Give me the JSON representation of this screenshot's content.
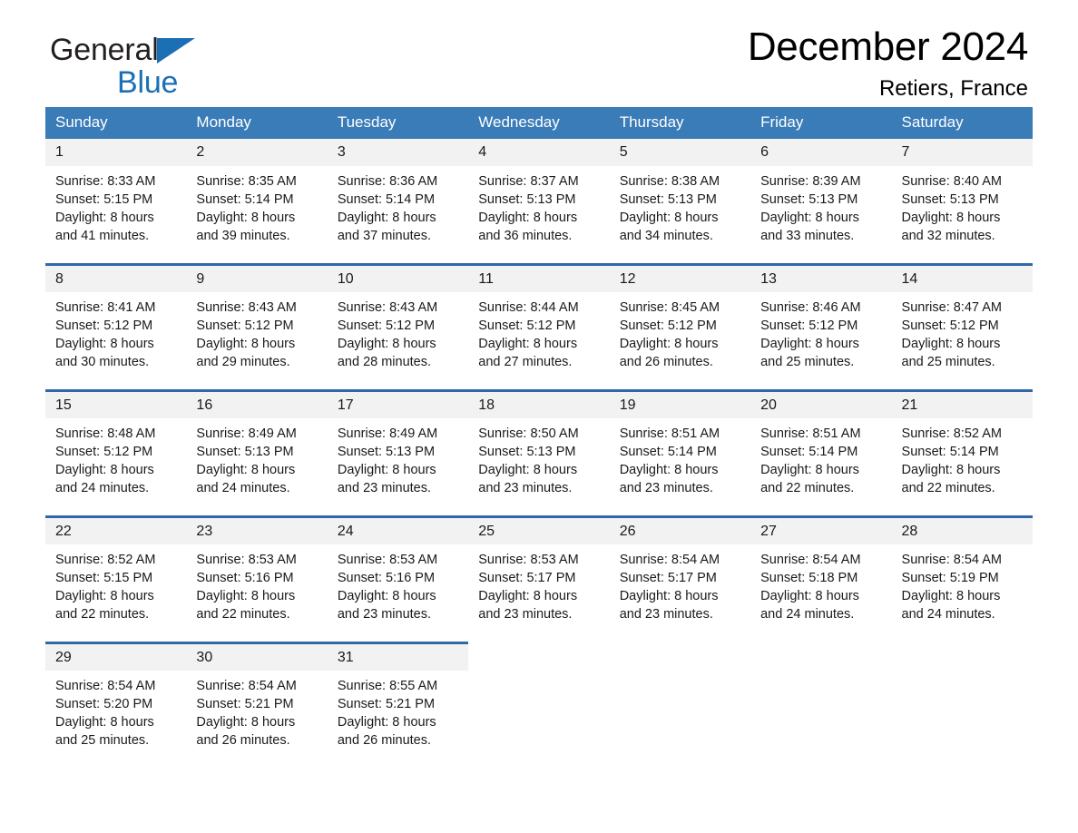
{
  "brand": {
    "word1": "General",
    "word2": "Blue",
    "flag_icon": "triangle-flag-icon",
    "accent_color": "#1a6fb5"
  },
  "header": {
    "month_title": "December 2024",
    "location": "Retiers, France"
  },
  "calendar": {
    "header_bg": "#3a7cb8",
    "daynum_bg": "#f2f2f2",
    "row_rule_color": "#2f6aa8",
    "weekday_headers": [
      "Sunday",
      "Monday",
      "Tuesday",
      "Wednesday",
      "Thursday",
      "Friday",
      "Saturday"
    ],
    "weeks": [
      [
        {
          "day": "1",
          "sunrise": "Sunrise: 8:33 AM",
          "sunset": "Sunset: 5:15 PM",
          "daylight_line1": "Daylight: 8 hours",
          "daylight_line2": "and 41 minutes."
        },
        {
          "day": "2",
          "sunrise": "Sunrise: 8:35 AM",
          "sunset": "Sunset: 5:14 PM",
          "daylight_line1": "Daylight: 8 hours",
          "daylight_line2": "and 39 minutes."
        },
        {
          "day": "3",
          "sunrise": "Sunrise: 8:36 AM",
          "sunset": "Sunset: 5:14 PM",
          "daylight_line1": "Daylight: 8 hours",
          "daylight_line2": "and 37 minutes."
        },
        {
          "day": "4",
          "sunrise": "Sunrise: 8:37 AM",
          "sunset": "Sunset: 5:13 PM",
          "daylight_line1": "Daylight: 8 hours",
          "daylight_line2": "and 36 minutes."
        },
        {
          "day": "5",
          "sunrise": "Sunrise: 8:38 AM",
          "sunset": "Sunset: 5:13 PM",
          "daylight_line1": "Daylight: 8 hours",
          "daylight_line2": "and 34 minutes."
        },
        {
          "day": "6",
          "sunrise": "Sunrise: 8:39 AM",
          "sunset": "Sunset: 5:13 PM",
          "daylight_line1": "Daylight: 8 hours",
          "daylight_line2": "and 33 minutes."
        },
        {
          "day": "7",
          "sunrise": "Sunrise: 8:40 AM",
          "sunset": "Sunset: 5:13 PM",
          "daylight_line1": "Daylight: 8 hours",
          "daylight_line2": "and 32 minutes."
        }
      ],
      [
        {
          "day": "8",
          "sunrise": "Sunrise: 8:41 AM",
          "sunset": "Sunset: 5:12 PM",
          "daylight_line1": "Daylight: 8 hours",
          "daylight_line2": "and 30 minutes."
        },
        {
          "day": "9",
          "sunrise": "Sunrise: 8:43 AM",
          "sunset": "Sunset: 5:12 PM",
          "daylight_line1": "Daylight: 8 hours",
          "daylight_line2": "and 29 minutes."
        },
        {
          "day": "10",
          "sunrise": "Sunrise: 8:43 AM",
          "sunset": "Sunset: 5:12 PM",
          "daylight_line1": "Daylight: 8 hours",
          "daylight_line2": "and 28 minutes."
        },
        {
          "day": "11",
          "sunrise": "Sunrise: 8:44 AM",
          "sunset": "Sunset: 5:12 PM",
          "daylight_line1": "Daylight: 8 hours",
          "daylight_line2": "and 27 minutes."
        },
        {
          "day": "12",
          "sunrise": "Sunrise: 8:45 AM",
          "sunset": "Sunset: 5:12 PM",
          "daylight_line1": "Daylight: 8 hours",
          "daylight_line2": "and 26 minutes."
        },
        {
          "day": "13",
          "sunrise": "Sunrise: 8:46 AM",
          "sunset": "Sunset: 5:12 PM",
          "daylight_line1": "Daylight: 8 hours",
          "daylight_line2": "and 25 minutes."
        },
        {
          "day": "14",
          "sunrise": "Sunrise: 8:47 AM",
          "sunset": "Sunset: 5:12 PM",
          "daylight_line1": "Daylight: 8 hours",
          "daylight_line2": "and 25 minutes."
        }
      ],
      [
        {
          "day": "15",
          "sunrise": "Sunrise: 8:48 AM",
          "sunset": "Sunset: 5:12 PM",
          "daylight_line1": "Daylight: 8 hours",
          "daylight_line2": "and 24 minutes."
        },
        {
          "day": "16",
          "sunrise": "Sunrise: 8:49 AM",
          "sunset": "Sunset: 5:13 PM",
          "daylight_line1": "Daylight: 8 hours",
          "daylight_line2": "and 24 minutes."
        },
        {
          "day": "17",
          "sunrise": "Sunrise: 8:49 AM",
          "sunset": "Sunset: 5:13 PM",
          "daylight_line1": "Daylight: 8 hours",
          "daylight_line2": "and 23 minutes."
        },
        {
          "day": "18",
          "sunrise": "Sunrise: 8:50 AM",
          "sunset": "Sunset: 5:13 PM",
          "daylight_line1": "Daylight: 8 hours",
          "daylight_line2": "and 23 minutes."
        },
        {
          "day": "19",
          "sunrise": "Sunrise: 8:51 AM",
          "sunset": "Sunset: 5:14 PM",
          "daylight_line1": "Daylight: 8 hours",
          "daylight_line2": "and 23 minutes."
        },
        {
          "day": "20",
          "sunrise": "Sunrise: 8:51 AM",
          "sunset": "Sunset: 5:14 PM",
          "daylight_line1": "Daylight: 8 hours",
          "daylight_line2": "and 22 minutes."
        },
        {
          "day": "21",
          "sunrise": "Sunrise: 8:52 AM",
          "sunset": "Sunset: 5:14 PM",
          "daylight_line1": "Daylight: 8 hours",
          "daylight_line2": "and 22 minutes."
        }
      ],
      [
        {
          "day": "22",
          "sunrise": "Sunrise: 8:52 AM",
          "sunset": "Sunset: 5:15 PM",
          "daylight_line1": "Daylight: 8 hours",
          "daylight_line2": "and 22 minutes."
        },
        {
          "day": "23",
          "sunrise": "Sunrise: 8:53 AM",
          "sunset": "Sunset: 5:16 PM",
          "daylight_line1": "Daylight: 8 hours",
          "daylight_line2": "and 22 minutes."
        },
        {
          "day": "24",
          "sunrise": "Sunrise: 8:53 AM",
          "sunset": "Sunset: 5:16 PM",
          "daylight_line1": "Daylight: 8 hours",
          "daylight_line2": "and 23 minutes."
        },
        {
          "day": "25",
          "sunrise": "Sunrise: 8:53 AM",
          "sunset": "Sunset: 5:17 PM",
          "daylight_line1": "Daylight: 8 hours",
          "daylight_line2": "and 23 minutes."
        },
        {
          "day": "26",
          "sunrise": "Sunrise: 8:54 AM",
          "sunset": "Sunset: 5:17 PM",
          "daylight_line1": "Daylight: 8 hours",
          "daylight_line2": "and 23 minutes."
        },
        {
          "day": "27",
          "sunrise": "Sunrise: 8:54 AM",
          "sunset": "Sunset: 5:18 PM",
          "daylight_line1": "Daylight: 8 hours",
          "daylight_line2": "and 24 minutes."
        },
        {
          "day": "28",
          "sunrise": "Sunrise: 8:54 AM",
          "sunset": "Sunset: 5:19 PM",
          "daylight_line1": "Daylight: 8 hours",
          "daylight_line2": "and 24 minutes."
        }
      ],
      [
        {
          "day": "29",
          "sunrise": "Sunrise: 8:54 AM",
          "sunset": "Sunset: 5:20 PM",
          "daylight_line1": "Daylight: 8 hours",
          "daylight_line2": "and 25 minutes."
        },
        {
          "day": "30",
          "sunrise": "Sunrise: 8:54 AM",
          "sunset": "Sunset: 5:21 PM",
          "daylight_line1": "Daylight: 8 hours",
          "daylight_line2": "and 26 minutes."
        },
        {
          "day": "31",
          "sunrise": "Sunrise: 8:55 AM",
          "sunset": "Sunset: 5:21 PM",
          "daylight_line1": "Daylight: 8 hours",
          "daylight_line2": "and 26 minutes."
        },
        {
          "day": "",
          "sunrise": "",
          "sunset": "",
          "daylight_line1": "",
          "daylight_line2": ""
        },
        {
          "day": "",
          "sunrise": "",
          "sunset": "",
          "daylight_line1": "",
          "daylight_line2": ""
        },
        {
          "day": "",
          "sunrise": "",
          "sunset": "",
          "daylight_line1": "",
          "daylight_line2": ""
        },
        {
          "day": "",
          "sunrise": "",
          "sunset": "",
          "daylight_line1": "",
          "daylight_line2": ""
        }
      ]
    ]
  }
}
